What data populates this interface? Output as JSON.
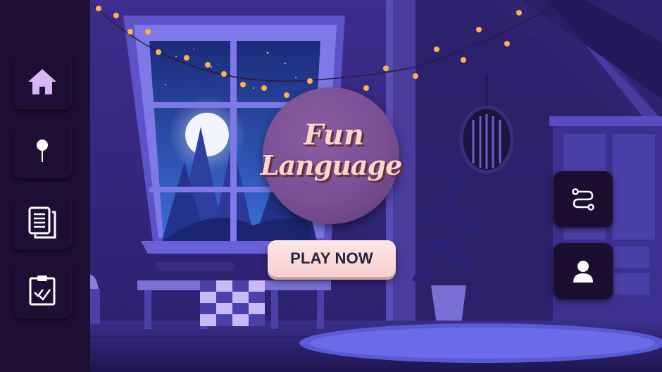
{
  "game": {
    "title_line1": "Fun",
    "title_line2": "Language",
    "play_label": "PLAY NOW"
  },
  "sidebar": {
    "items": [
      {
        "icon": "home-icon"
      },
      {
        "icon": "pin-icon"
      },
      {
        "icon": "documents-icon"
      },
      {
        "icon": "clipboard-check-icon"
      }
    ]
  },
  "right_panel": {
    "items": [
      {
        "icon": "route-icon"
      },
      {
        "icon": "user-icon"
      }
    ]
  },
  "colors": {
    "sidebar_bg": "#1d0e33",
    "logo_circle": "#7a4f94",
    "logo_text": "#f7d7cf",
    "play_button": "#fbdcdb",
    "play_text": "#24243a",
    "active_icon": "#d7b8f7"
  }
}
